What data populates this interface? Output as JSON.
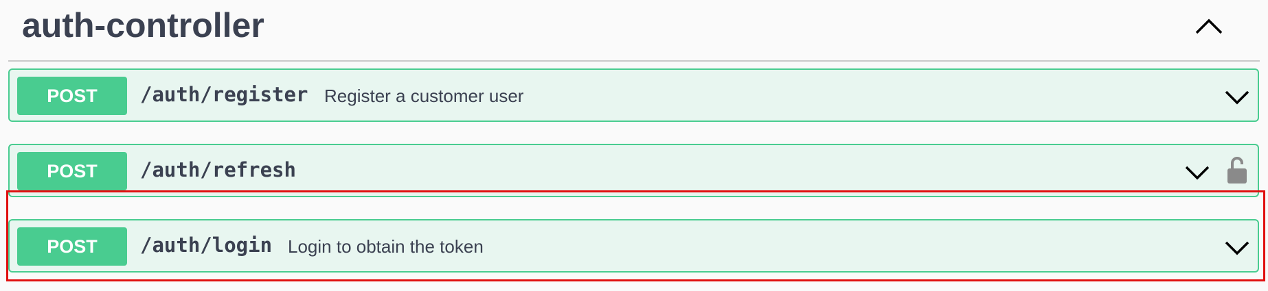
{
  "section": {
    "title": "auth-controller",
    "collapse_icon": "chevron-up-icon"
  },
  "operations": [
    {
      "method": "POST",
      "path": "/auth/register",
      "summary": "Register a customer user",
      "color": "#49cc90",
      "locked": false
    },
    {
      "method": "POST",
      "path": "/auth/refresh",
      "summary": "",
      "color": "#49cc90",
      "locked": true,
      "lock_icon": "unlocked-padlock-icon"
    },
    {
      "method": "POST",
      "path": "/auth/login",
      "summary": "Login to obtain the token",
      "color": "#49cc90",
      "locked": false,
      "highlighted": true
    }
  ],
  "colors": {
    "post_accent": "#49cc90",
    "post_background": "#e8f6f0",
    "highlight": "#e01010",
    "text": "#3b4151"
  }
}
